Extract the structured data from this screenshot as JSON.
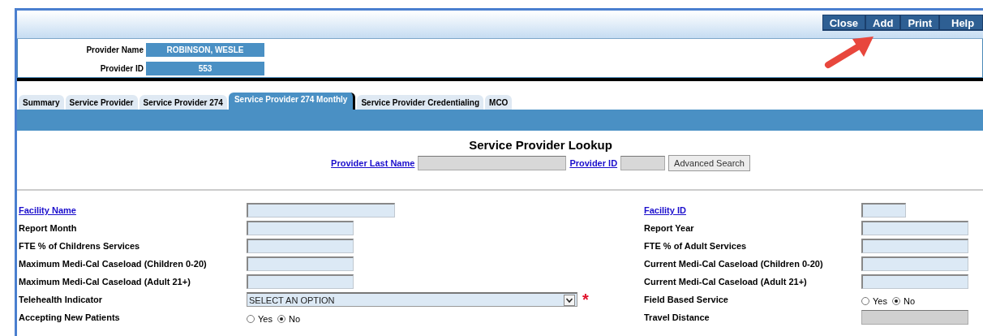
{
  "toolbar": {
    "buttons": [
      {
        "label": "Close"
      },
      {
        "label": "Add"
      },
      {
        "label": "Print"
      },
      {
        "label": "Help"
      }
    ]
  },
  "provider": {
    "fields": [
      {
        "label": "Provider Name",
        "value": "ROBINSON, WESLE"
      },
      {
        "label": "Provider ID",
        "value": "553"
      }
    ]
  },
  "tabs": [
    {
      "label": "Summary",
      "selected": false
    },
    {
      "label": "Service Provider",
      "selected": false
    },
    {
      "label": "Service Provider 274",
      "selected": false
    },
    {
      "label": "Service Provider 274 Monthly",
      "selected": true
    },
    {
      "label": "Service Provider Credentialing",
      "selected": false
    },
    {
      "label": "MCO",
      "selected": false
    }
  ],
  "lookup": {
    "title": "Service Provider Lookup",
    "last_name_link": "Provider Last Name",
    "id_link": "Provider ID",
    "button": "Advanced Search"
  },
  "form": {
    "left": [
      {
        "label": "Facility Name",
        "link": true,
        "kind": "wide-input"
      },
      {
        "label": "Report Month",
        "link": false,
        "kind": "input"
      },
      {
        "label": "FTE % of Childrens Services",
        "link": false,
        "kind": "input"
      },
      {
        "label": "Maximum Medi-Cal Caseload (Children 0-20)",
        "link": false,
        "kind": "input"
      },
      {
        "label": "Maximum Medi-Cal Caseload (Adult 21+)",
        "link": false,
        "kind": "input"
      },
      {
        "label": "Telehealth Indicator",
        "link": false,
        "kind": "select",
        "value": "SELECT AN OPTION",
        "required_mark": "*"
      },
      {
        "label": "Accepting New Patients",
        "link": false,
        "kind": "radio",
        "options": [
          {
            "label": "Yes",
            "selected": false
          },
          {
            "label": "No",
            "selected": true
          }
        ]
      }
    ],
    "right": [
      {
        "label": "Facility ID",
        "link": true,
        "kind": "short-input"
      },
      {
        "label": "Report Year",
        "link": false,
        "kind": "input"
      },
      {
        "label": "FTE % of Adult Services",
        "link": false,
        "kind": "input"
      },
      {
        "label": "Current Medi-Cal Caseload (Children 0-20)",
        "link": false,
        "kind": "input"
      },
      {
        "label": "Current Medi-Cal Caseload (Adult 21+)",
        "link": false,
        "kind": "input"
      },
      {
        "label": "Field Based Service",
        "link": false,
        "kind": "radio",
        "options": [
          {
            "label": "Yes",
            "selected": false
          },
          {
            "label": "No",
            "selected": true
          }
        ]
      },
      {
        "label": "Travel Distance",
        "link": false,
        "kind": "readonly"
      }
    ]
  }
}
